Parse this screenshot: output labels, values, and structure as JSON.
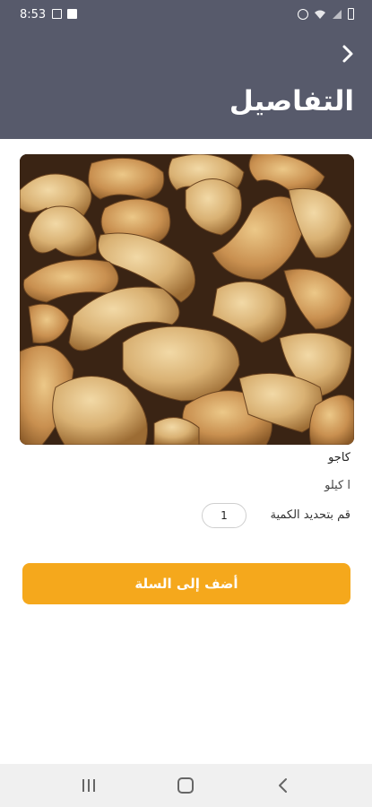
{
  "status_bar": {
    "time": "8:53"
  },
  "header": {
    "title": "التفاصيل"
  },
  "product": {
    "name": "كاجو",
    "unit": "ا كيلو",
    "quantity_label": "قم بتحديد الكمية",
    "quantity_value": "1"
  },
  "actions": {
    "add_to_cart_label": "أضف إلى السلة"
  },
  "colors": {
    "header": "#575a6b",
    "accent": "#f5a81c"
  },
  "icons": [
    "back-arrow-icon",
    "recents-icon",
    "home-icon",
    "nav-back-icon"
  ]
}
